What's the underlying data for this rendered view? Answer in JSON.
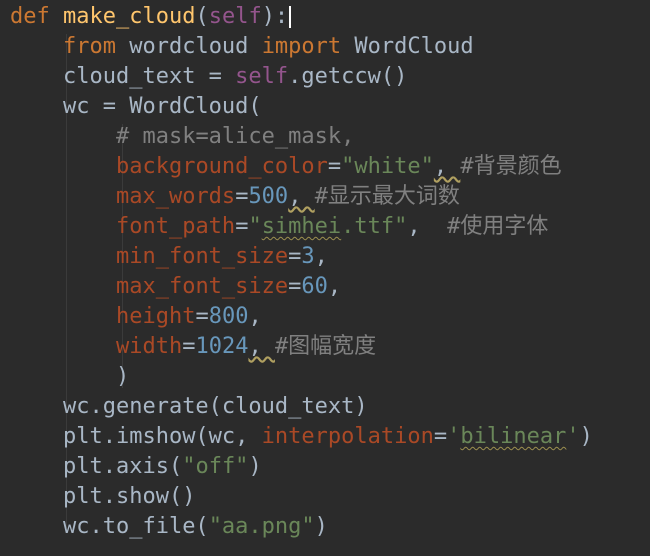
{
  "code": {
    "l1": {
      "def": "def",
      "name": "make_cloud",
      "open": "(",
      "self": "self",
      "close": "):"
    },
    "l2": {
      "from": "from",
      "module": "wordcloud",
      "import": "import",
      "cls": "WordCloud"
    },
    "l3": {
      "lhs": "cloud_text = ",
      "self": "self",
      "rest": ".getccw()"
    },
    "l4": {
      "text": "wc = WordCloud("
    },
    "l5": {
      "comment": "# mask=alice_mask,"
    },
    "l6": {
      "param": "background_color",
      "eq": "=",
      "val": "\"white\"",
      "sep": ", ",
      "comment": "#背景颜色"
    },
    "l7": {
      "param": "max_words",
      "eq": "=",
      "val": "500",
      "sep": ", ",
      "comment": "#显示最大词数"
    },
    "l8": {
      "param": "font_path",
      "eq": "=",
      "q1": "\"",
      "valtypo": "simhei",
      "q2": ".ttf\"",
      "sep": ",  ",
      "comment": "#使用字体"
    },
    "l9": {
      "param": "min_font_size",
      "eq": "=",
      "val": "3",
      "sep": ","
    },
    "l10": {
      "param": "max_font_size",
      "eq": "=",
      "val": "60",
      "sep": ","
    },
    "l11": {
      "param": "height",
      "eq": "=",
      "val": "800",
      "sep": ","
    },
    "l12": {
      "param": "width",
      "eq": "=",
      "val": "1024",
      "sep": ", ",
      "comment": "#图幅宽度"
    },
    "l13": {
      "text": ")"
    },
    "l14": {
      "text": "wc.generate(cloud_text)"
    },
    "l15": {
      "pre": "plt.imshow(wc, ",
      "param": "interpolation",
      "eq": "=",
      "q1": "'",
      "valtypo": "bilinear",
      "q2": "'",
      "close": ")"
    },
    "l16": {
      "pre": "plt.axis(",
      "val": "\"off\"",
      "close": ")"
    },
    "l17": {
      "text": "plt.show()"
    },
    "l18": {
      "pre": "wc.to_file(",
      "val": "\"aa.png\"",
      "close": ")"
    }
  },
  "colors": {
    "background": "#2b2b2b",
    "keyword": "#cc7832",
    "function": "#ffc66d",
    "self": "#94558d",
    "string": "#6a8759",
    "number": "#6897bb",
    "parameter": "#aa4926",
    "comment": "#808080",
    "text": "#a9b7c6"
  }
}
